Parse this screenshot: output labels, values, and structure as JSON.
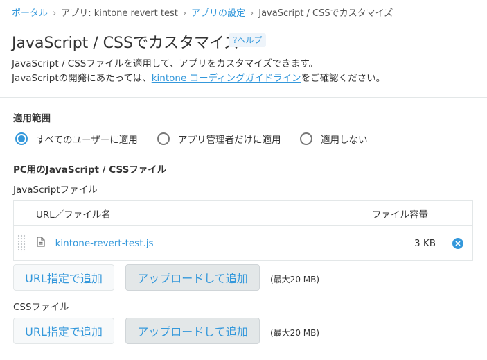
{
  "breadcrumb": {
    "portal": "ポータル",
    "app": "アプリ: kintone revert test",
    "app_settings": "アプリの設定",
    "current": "JavaScript / CSSでカスタマイズ"
  },
  "page": {
    "title": "JavaScript / CSSでカスタマイズ",
    "help_label": "?ヘルプ",
    "desc_line1": "JavaScript / CSSファイルを適用して、アプリをカスタマイズできます。",
    "desc_line2_before": "JavaScriptの開発にあたっては、",
    "desc_link": "kintone コーディングガイドライン",
    "desc_line2_after": "をご確認ください。"
  },
  "scope": {
    "heading": "適用範囲",
    "options": [
      {
        "label": "すべてのユーザーに適用",
        "selected": true
      },
      {
        "label": "アプリ管理者だけに適用",
        "selected": false
      },
      {
        "label": "適用しない",
        "selected": false
      }
    ]
  },
  "pc_section": {
    "heading": "PC用のJavaScript / CSSファイル",
    "js_label": "JavaScriptファイル",
    "table": {
      "col_name": "URL／ファイル名",
      "col_size": "ファイル容量",
      "rows": [
        {
          "name": "kintone-revert-test.js",
          "size": "3 KB"
        }
      ]
    },
    "js_buttons": {
      "url": "URL指定で追加",
      "upload": "アップロードして追加",
      "max": "(最大20 MB)"
    },
    "css_label": "CSSファイル",
    "css_buttons": {
      "url": "URL指定で追加",
      "upload": "アップロードして追加",
      "max": "(最大20 MB)"
    }
  },
  "icons": {
    "file": "file-icon",
    "delete": "close-circle-icon",
    "drag": "drag-handle-icon"
  },
  "colors": {
    "accent": "#3498db",
    "button_gray": "#e3e7e8"
  }
}
